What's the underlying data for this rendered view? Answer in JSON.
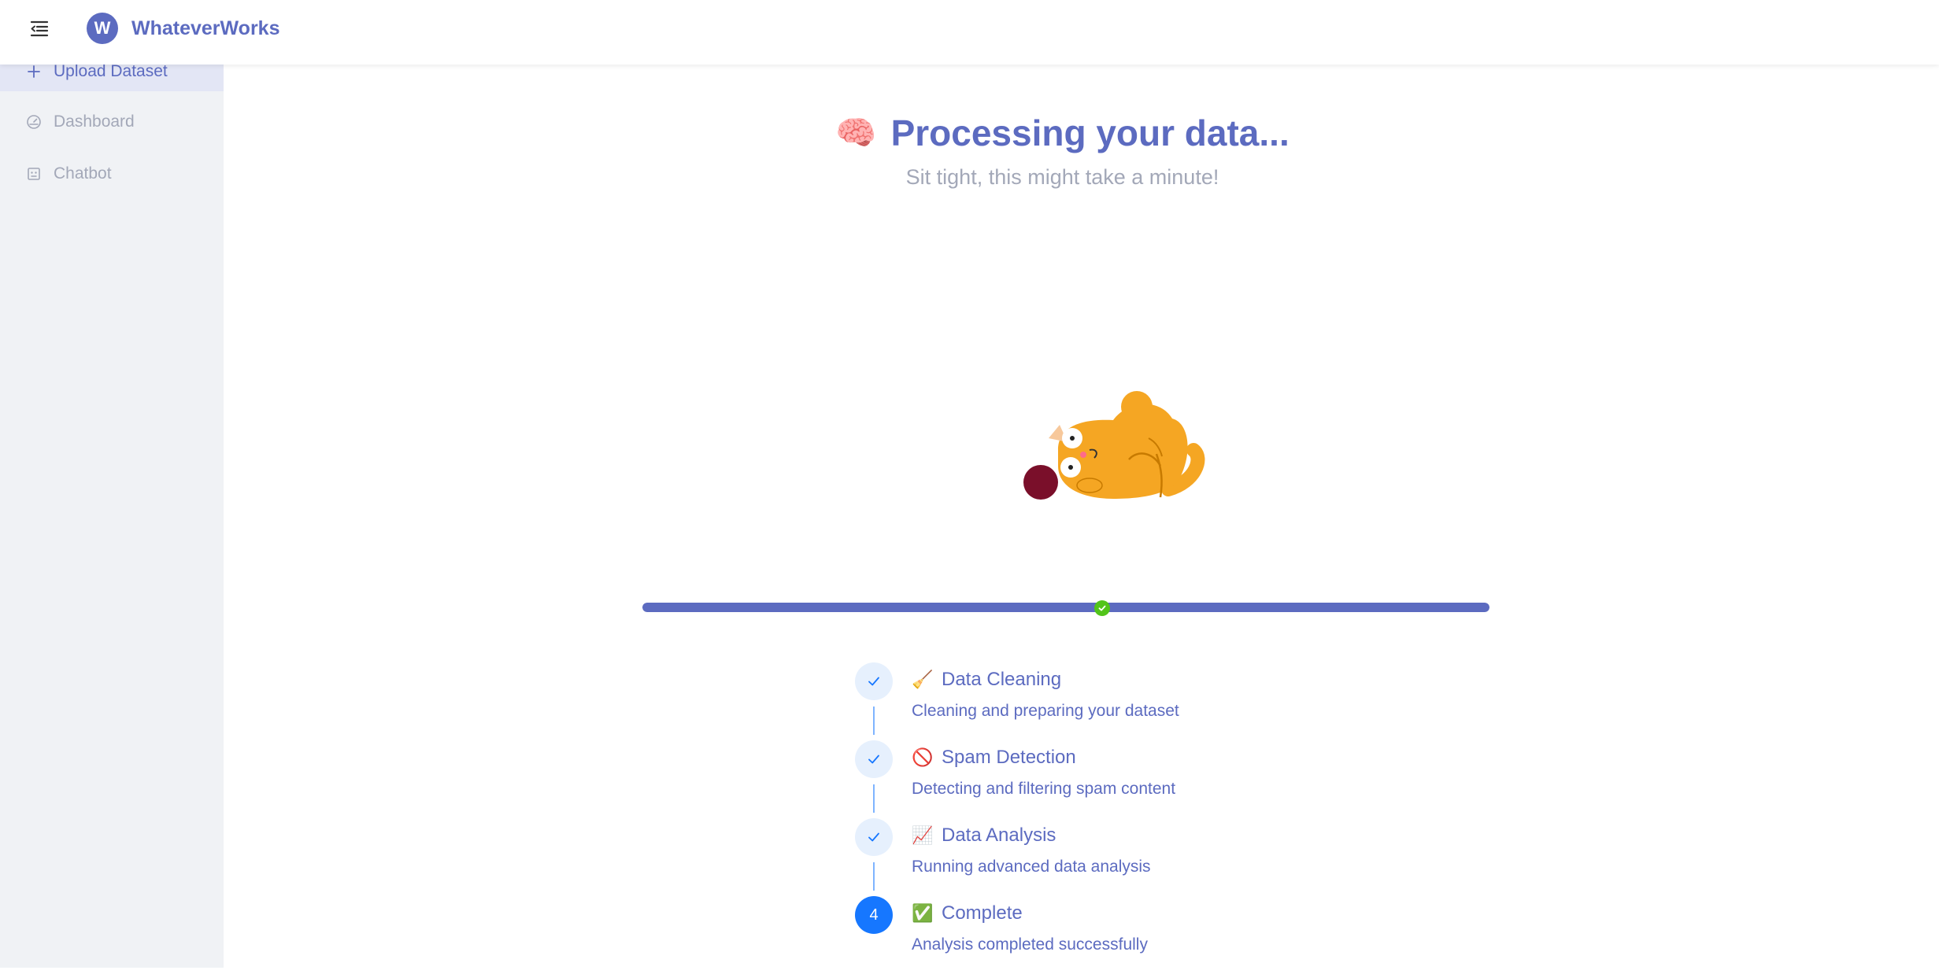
{
  "app": {
    "name": "WhateverWorks",
    "logo_letter": "W"
  },
  "sidebar": {
    "items": [
      {
        "label": "Upload Dataset",
        "icon": "plus-icon",
        "active": true
      },
      {
        "label": "Dashboard",
        "icon": "dashboard-icon",
        "active": false
      },
      {
        "label": "Chatbot",
        "icon": "robot-icon",
        "active": false
      }
    ]
  },
  "main": {
    "title_emoji": "🧠",
    "title": "Processing your data...",
    "subtitle": "Sit tight, this might take a minute!",
    "illustration": "cat-playing-with-yarn",
    "progress": {
      "percent": 100,
      "status": "success"
    },
    "steps": [
      {
        "emoji": "🧹",
        "title": "Data Cleaning",
        "description": "Cleaning and preparing your dataset",
        "status": "finished"
      },
      {
        "emoji": "🚫",
        "title": "Spam Detection",
        "description": "Detecting and filtering spam content",
        "status": "finished"
      },
      {
        "emoji": "📈",
        "title": "Data Analysis",
        "description": "Running advanced data analysis",
        "status": "finished"
      },
      {
        "emoji": "✅",
        "title": "Complete",
        "description": "Analysis completed successfully",
        "status": "current",
        "number": "4"
      }
    ]
  },
  "colors": {
    "brand": "#5c6bc0",
    "success": "#52c41a",
    "step_blue": "#1677ff",
    "sidebar_bg": "#f0f2f5"
  }
}
